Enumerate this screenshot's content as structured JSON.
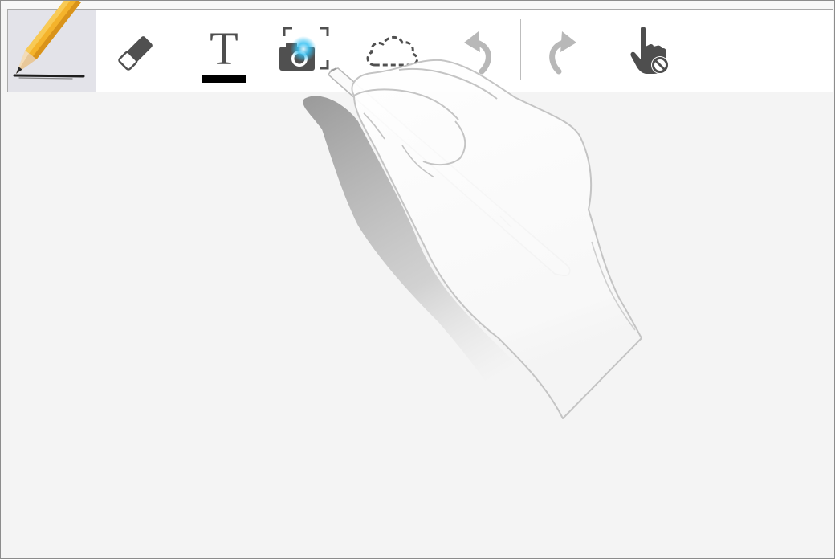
{
  "toolbar": {
    "tools": [
      {
        "id": "pen",
        "icon": "pencil-icon",
        "active": true
      },
      {
        "id": "eraser",
        "icon": "eraser-icon",
        "active": false
      },
      {
        "id": "text",
        "icon": "text-icon",
        "glyph": "T",
        "active": false
      },
      {
        "id": "capture",
        "icon": "camera-capture-icon",
        "active": false
      },
      {
        "id": "lasso",
        "icon": "cloud-lasso-icon",
        "active": false
      },
      {
        "id": "undo",
        "icon": "undo-icon",
        "enabled": false
      },
      {
        "id": "redo",
        "icon": "redo-icon",
        "enabled": false
      },
      {
        "id": "touch",
        "icon": "touch-disabled-icon",
        "active": false
      }
    ]
  },
  "colors": {
    "active_tool_bg": "#e3e3e9",
    "icon_dark": "#4e4e4e",
    "icon_disabled": "#b8b8b8",
    "canvas_bg": "#f4f4f4",
    "highlight_blue": "#37c1f2"
  }
}
